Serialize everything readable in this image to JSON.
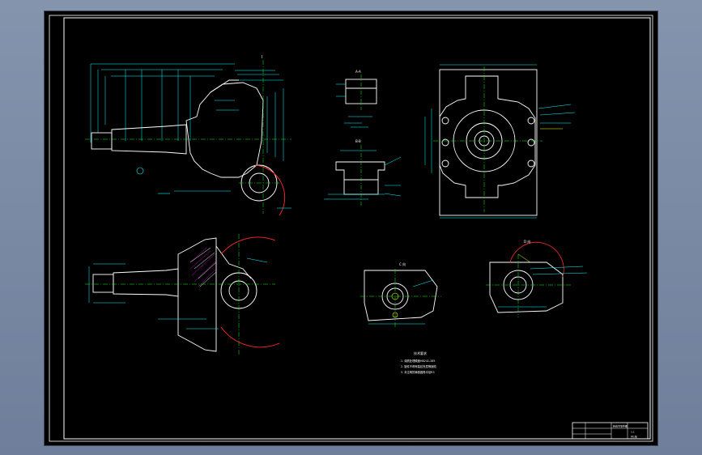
{
  "app": {
    "background": "#7a8aa6",
    "canvas_background": "#000000"
  },
  "colors": {
    "frame": "#ffffff",
    "geometry": "#ffffff",
    "dimension": "#00ffff",
    "centerline": "#00ff00",
    "annotation": "#ffff00",
    "leader": "#ff00ff",
    "highlight_red": "#ff2a2a"
  },
  "drawing": {
    "views": [
      {
        "name": "main-view",
        "label": "I"
      },
      {
        "name": "section-view-a",
        "label": "A-A"
      },
      {
        "name": "section-view-b",
        "label": "B-B"
      },
      {
        "name": "right-view",
        "label": ""
      },
      {
        "name": "section-view-bottom-left",
        "label": ""
      },
      {
        "name": "detail-view-c",
        "label": "C 向"
      },
      {
        "name": "detail-view-d",
        "label": "D 向"
      }
    ],
    "tech_requirements": {
      "title": "技术要求",
      "items": [
        "1. 调质处理硬度HB241-285",
        "2. 锻件不得有裂纹夹层等缺陷",
        "3. 未注明的铸造圆角半径R3"
      ]
    },
    "title_block": {
      "part_name": "转向节零件图",
      "scale": "1:1",
      "sheet": "共1张"
    }
  }
}
